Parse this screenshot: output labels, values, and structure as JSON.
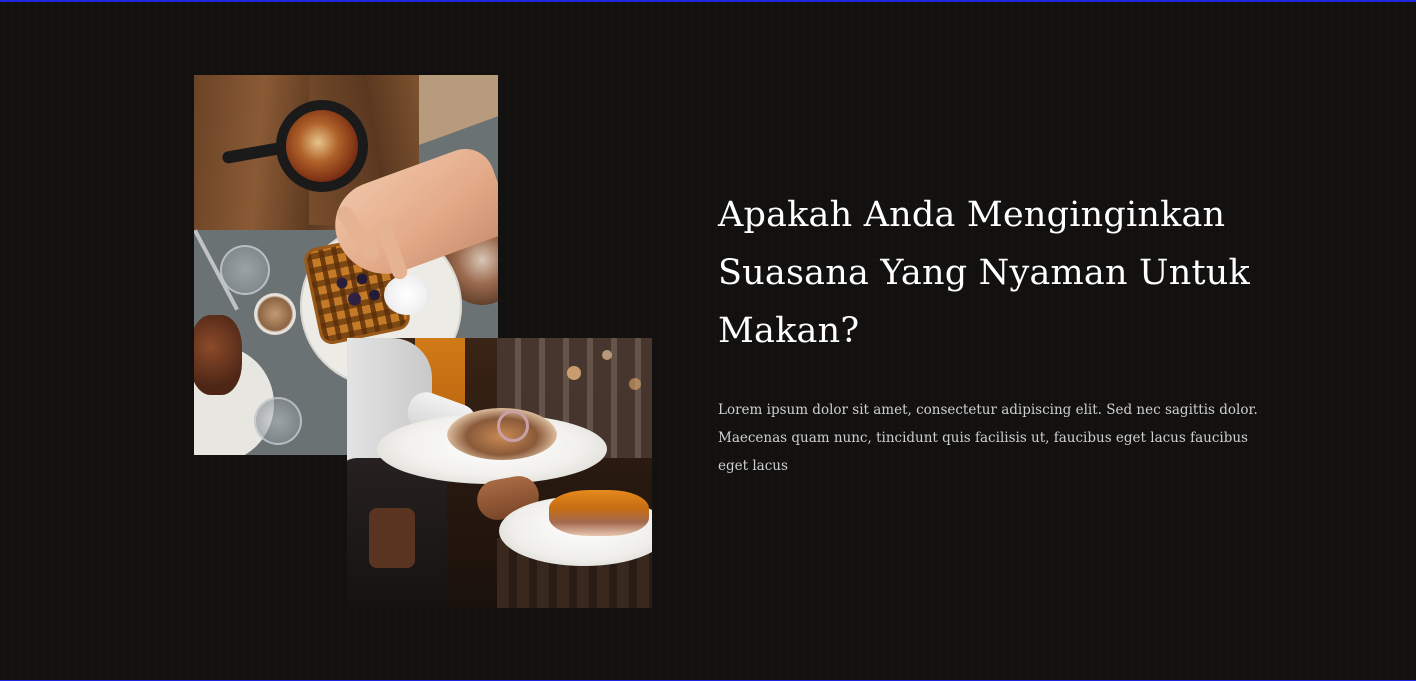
{
  "section": {
    "heading": "Apakah Anda Menginginkan Suasana Yang Nyaman Untuk Makan?",
    "description": "Lorem ipsum dolor sit amet, consectetur adipiscing elit. Sed nec sagittis dolor. Maecenas quam nunc, tincidunt quis facilisis ut, faucibus eget lacus faucibus eget lacus"
  },
  "images": [
    {
      "name": "overhead-breakfast-table-photo"
    },
    {
      "name": "waiter-serving-plates-photo"
    }
  ],
  "colors": {
    "background": "#121110",
    "heading_text": "#ffffff",
    "body_text": "#cfcfcf",
    "border_accent": "#1f24e0"
  }
}
